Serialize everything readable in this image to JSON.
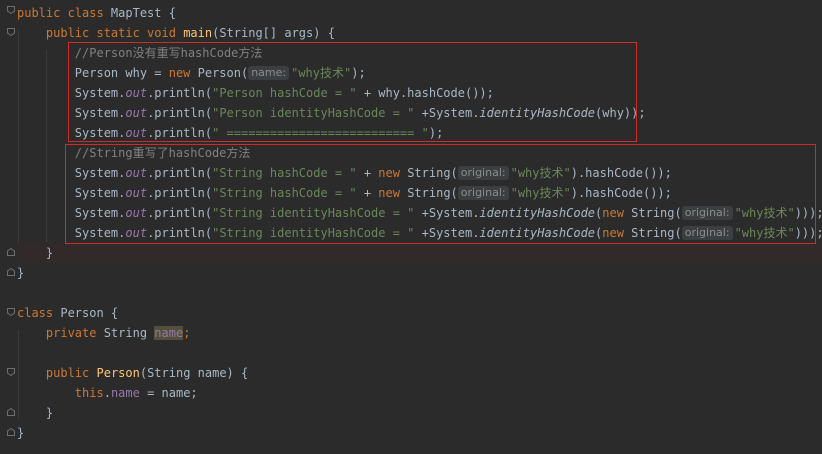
{
  "colors": {
    "background": "#2b2b2b",
    "keyword": "#cc7832",
    "string": "#6a8759",
    "comment": "#808080",
    "method": "#ffc66d",
    "field": "#9876aa",
    "highlight_box": "#d12a2a"
  },
  "code": {
    "l1": {
      "kw": "public class",
      "name": " MapTest {"
    },
    "l2": {
      "kw": "public static void",
      "fn": "main",
      "rest": "(String[] args) {"
    },
    "l3": {
      "comment": "//Person没有重写hashCode方法"
    },
    "l4": {
      "a": "Person why = ",
      "kw": "new",
      "b": " Person(",
      "hint": "name:",
      "str": "\"why技术\"",
      "c": ");"
    },
    "l5": {
      "a": "System.",
      "out": "out",
      "b": ".println(",
      "str": "\"Person hashCode = \"",
      "c": " + why.hashCode());"
    },
    "l6": {
      "a": "System.",
      "out": "out",
      "b": ".println(",
      "str": "\"Person identityHashCode = \"",
      "c": " +System.",
      "m": "identityHashCode",
      "d": "(why));"
    },
    "l7": {
      "a": "System.",
      "out": "out",
      "b": ".println(",
      "str": "\" ========================== \"",
      "c": ");"
    },
    "l8": {
      "comment": "//String重写了hashCode方法"
    },
    "l9": {
      "a": "System.",
      "out": "out",
      "b": ".println(",
      "str": "\"String hashCode = \"",
      "c": " + ",
      "kw": "new",
      "d": " String(",
      "hint": "original:",
      "str2": "\"why技术\"",
      "e": ").hashCode());"
    },
    "l10": {
      "a": "System.",
      "out": "out",
      "b": ".println(",
      "str": "\"String hashCode = \"",
      "c": " + ",
      "kw": "new",
      "d": " String(",
      "hint": "original:",
      "str2": "\"why技术\"",
      "e": ").hashCode());"
    },
    "l11": {
      "a": "System.",
      "out": "out",
      "b": ".println(",
      "str": "\"String identityHashCode = \"",
      "c": " +System.",
      "m": "identityHashCode",
      "d": "(",
      "kw": "new",
      "e": " String(",
      "hint": "original:",
      "str2": "\"why技术\"",
      "f": ")));"
    },
    "l12": {
      "a": "System.",
      "out": "out",
      "b": ".println(",
      "str": "\"String identityHashCode = \"",
      "c": " +System.",
      "m": "identityHashCode",
      "d": "(",
      "kw": "new",
      "e": " String(",
      "hint": "original:",
      "str2": "\"why技术\"",
      "f": ")));"
    },
    "l13": {
      "text": "}"
    },
    "l14": {
      "text": "}"
    },
    "l15": {
      "text": ""
    },
    "l16": {
      "kw": "class",
      "name": " Person {"
    },
    "l17": {
      "kw": "private",
      "a": " String ",
      "field": "name",
      "b": ";"
    },
    "l18": {
      "text": ""
    },
    "l19": {
      "kw": "public",
      "fn": "Person",
      "rest": "(String name) {"
    },
    "l20": {
      "kw": "this",
      "a": ".",
      "field": "name",
      "b": " = name;"
    },
    "l21": {
      "text": "}"
    },
    "l22": {
      "text": "}"
    }
  }
}
